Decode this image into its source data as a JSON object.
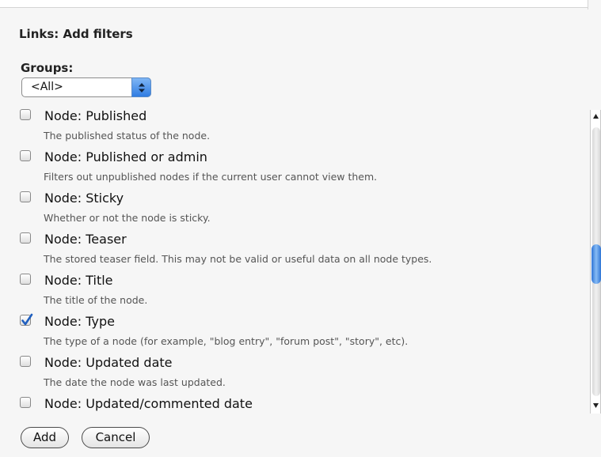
{
  "form": {
    "title": "Links: Add filters",
    "groups_label": "Groups:",
    "groups_value": "<All>"
  },
  "filters": [
    {
      "label": "Node: Published",
      "description": "The published status of the node.",
      "checked": false
    },
    {
      "label": "Node: Published or admin",
      "description": "Filters out unpublished nodes if the current user cannot view them.",
      "checked": false
    },
    {
      "label": "Node: Sticky",
      "description": "Whether or not the node is sticky.",
      "checked": false
    },
    {
      "label": "Node: Teaser",
      "description": "The stored teaser field. This may not be valid or useful data on all node types.",
      "checked": false
    },
    {
      "label": "Node: Title",
      "description": "The title of the node.",
      "checked": false
    },
    {
      "label": "Node: Type",
      "description": "The type of a node (for example, \"blog entry\", \"forum post\", \"story\", etc).",
      "checked": true
    },
    {
      "label": "Node: Updated date",
      "description": "The date the node was last updated.",
      "checked": false
    },
    {
      "label": "Node: Updated/commented date",
      "description": "",
      "checked": false
    }
  ],
  "buttons": {
    "add_label": "Add",
    "cancel_label": "Cancel"
  },
  "colors": {
    "accent": "#3a82e4",
    "checkmark": "#1f5fbf"
  }
}
